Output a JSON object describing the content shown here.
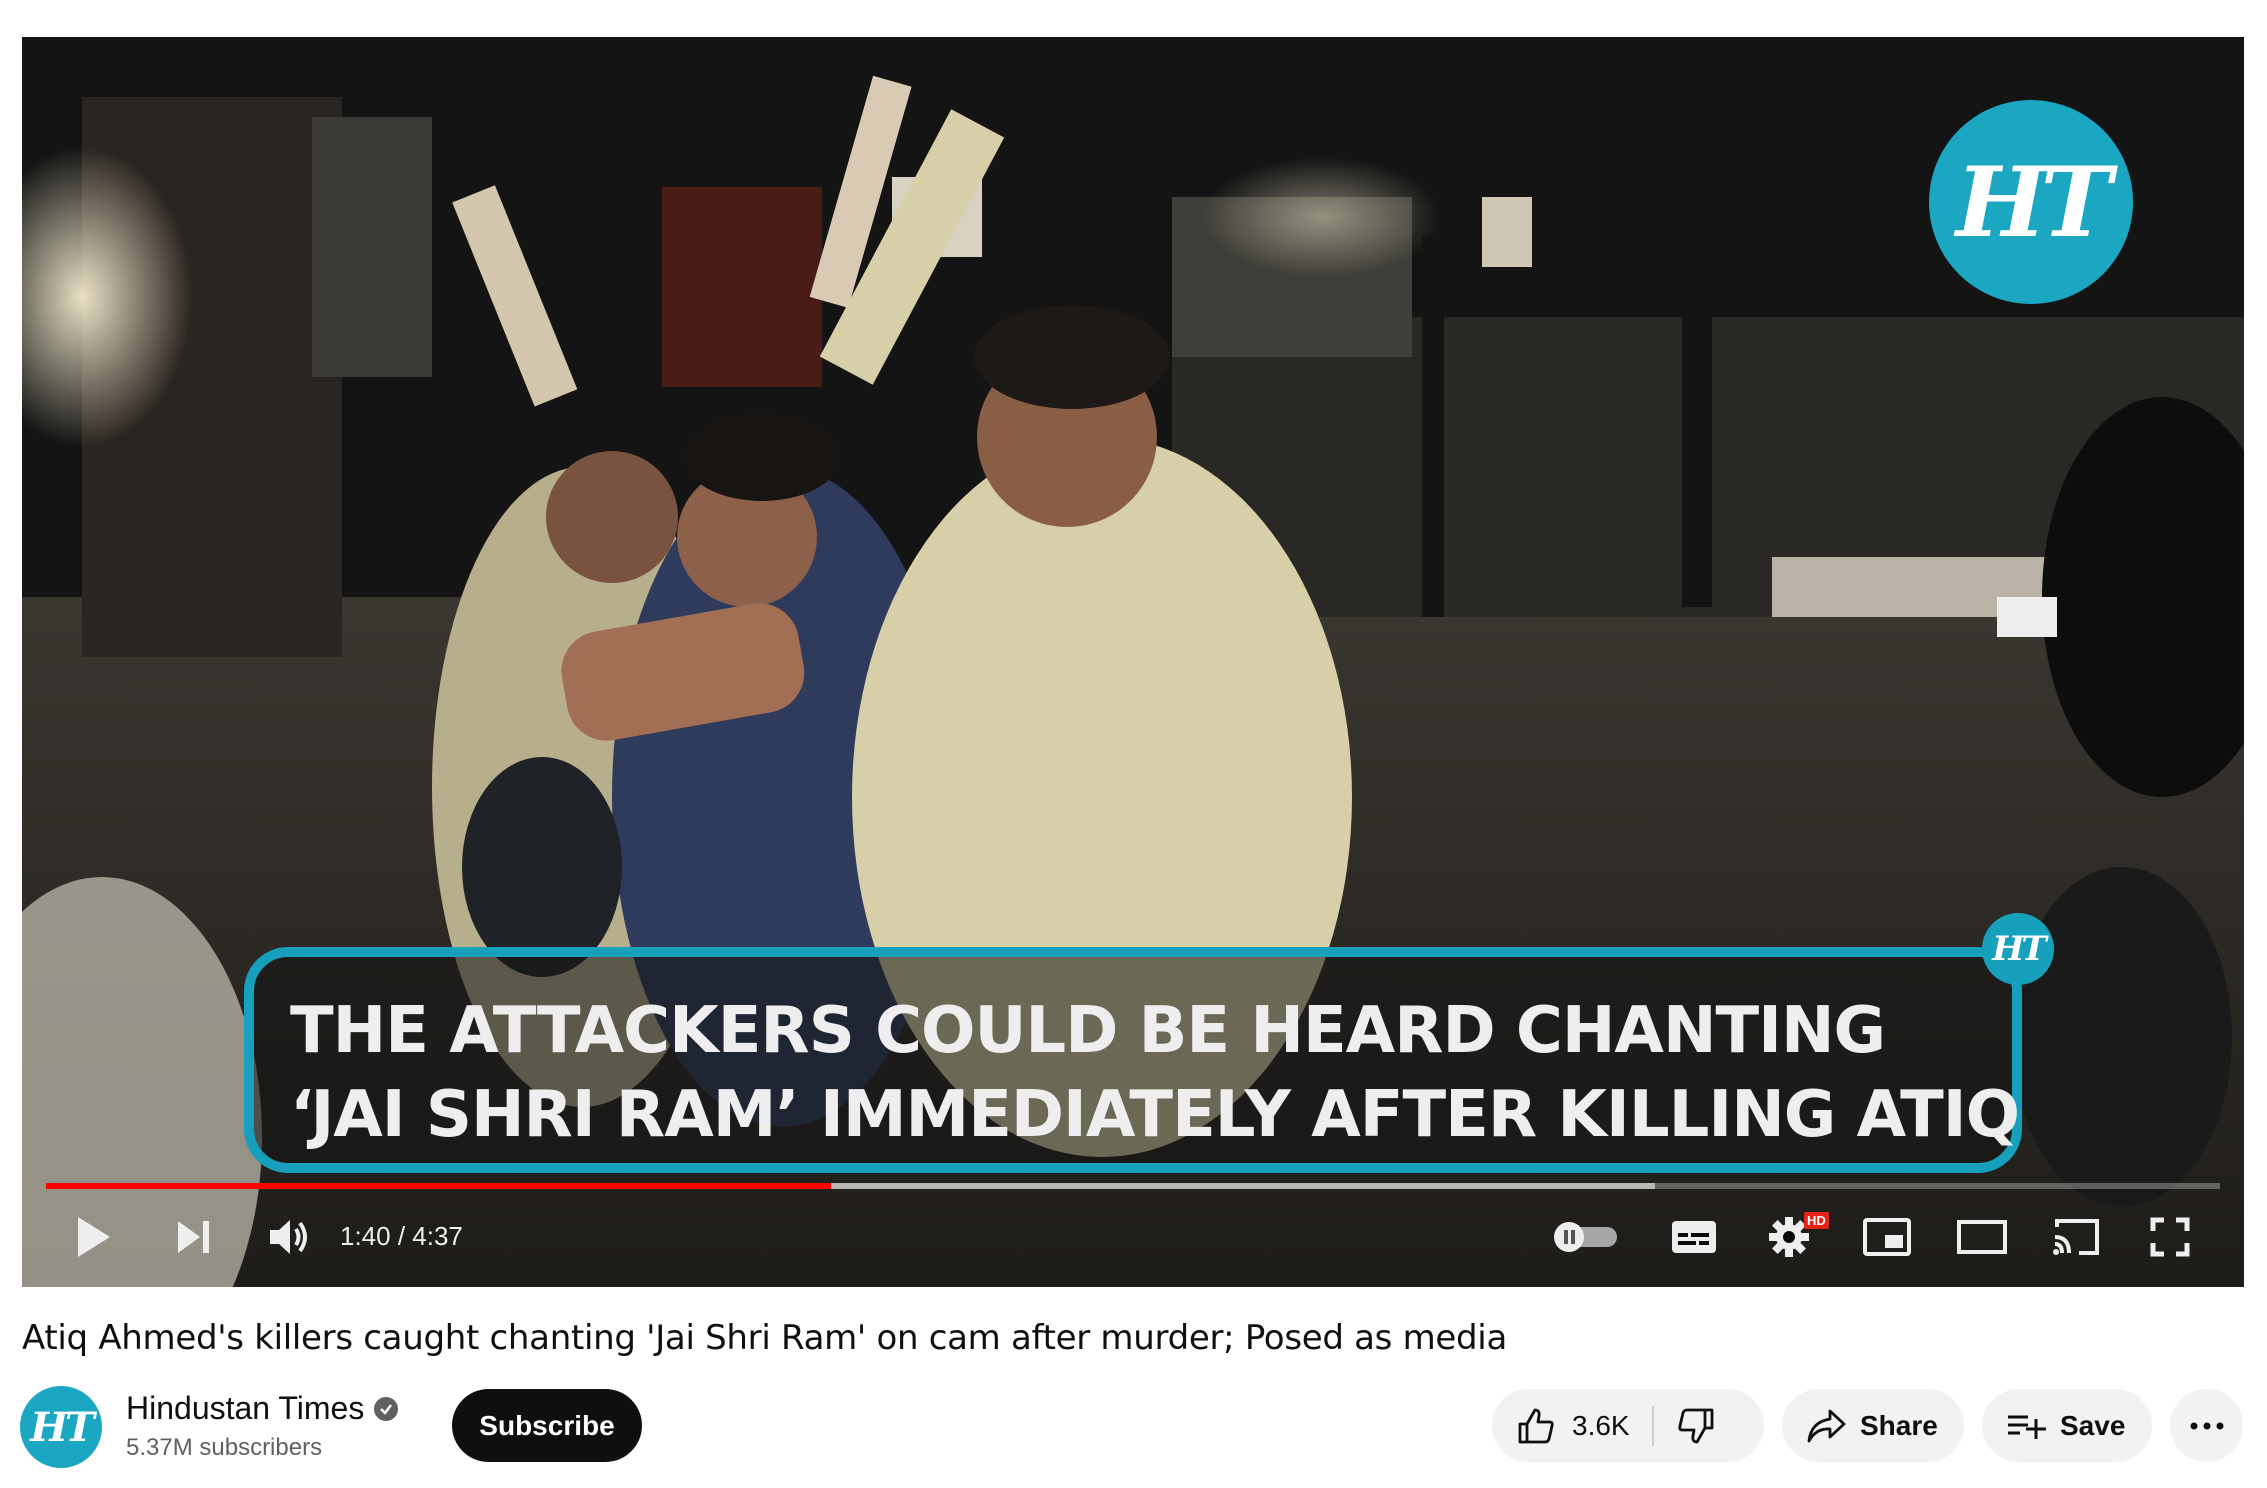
{
  "video": {
    "watermark_logo": "HT",
    "caption_line1": "THE ATTACKERS COULD BE HEARD CHANTING",
    "caption_line2": "‘JAI SHRI RAM’ IMMEDIATELY AFTER KILLING ATIQ",
    "caption_badge": "HT"
  },
  "player": {
    "current_time": "1:40",
    "duration": "4:37",
    "time_display": "1:40 / 4:37",
    "played_fraction": 0.361,
    "buffered_fraction": 0.74,
    "hd_badge": "HD",
    "controls": [
      "play-icon",
      "next-icon",
      "volume-icon",
      "autoplay-toggle",
      "subtitles-icon",
      "settings-icon",
      "miniplayer-icon",
      "theater-icon",
      "cast-icon",
      "fullscreen-icon"
    ]
  },
  "title": "Atiq Ahmed's killers caught chanting 'Jai Shri Ram' on cam after murder; Posed as media",
  "channel": {
    "avatar_text": "HT",
    "name": "Hindustan Times",
    "subscribers": "5.37M subscribers",
    "subscribe_label": "Subscribe"
  },
  "actions": {
    "likes": "3.6K",
    "share_label": "Share",
    "save_label": "Save"
  },
  "colors": {
    "brand": "#1ba7c2",
    "progress_played": "#ff0000",
    "hd_badge": "#e62117"
  }
}
